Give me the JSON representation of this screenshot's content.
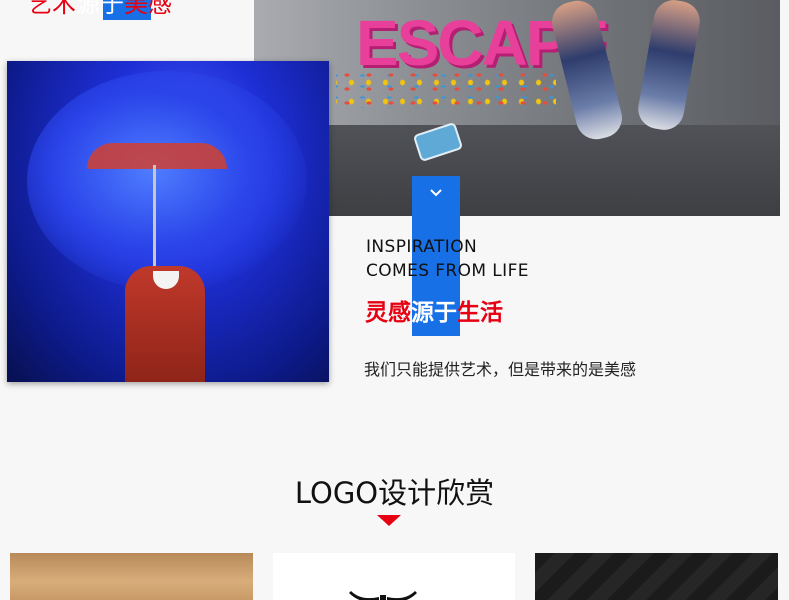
{
  "top_heading": {
    "part1": "艺术",
    "part2": "源于",
    "part3": "美感"
  },
  "photo_escape": {
    "sign_text": "ESCAPE"
  },
  "inspiration": {
    "line1": "INSPIRATION",
    "line2": "COMES FROM LIFE",
    "cn_part1": "灵感",
    "cn_part2": "源于",
    "cn_part3": "生活",
    "tagline": "我们只能提供艺术，但是带来的是美感"
  },
  "logo_section": {
    "title": "LOGO设计欣赏"
  },
  "icons": {
    "chevron": "chevron-down-icon",
    "arrow": "triangle-down-icon"
  },
  "colors": {
    "accent_blue": "#1770e6",
    "accent_red": "#e60012"
  }
}
